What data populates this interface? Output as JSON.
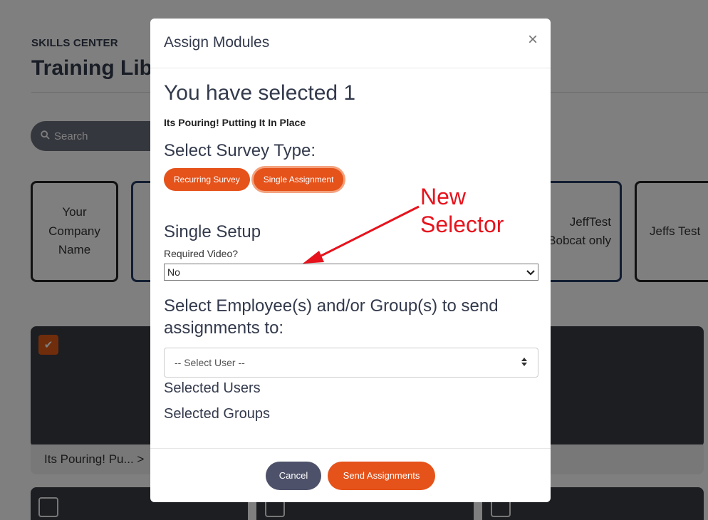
{
  "background": {
    "eyebrow": "SKILLS CENTER",
    "title": "Training Library",
    "search_placeholder": "Search",
    "cards": [
      {
        "label": "Your Company Name"
      },
      {
        "label": ""
      },
      {
        "label": "JeffTest Bobcat only"
      },
      {
        "label": "Jeffs Test"
      }
    ],
    "tile_caption": "Its Pouring! Pu... >"
  },
  "modal": {
    "title": "Assign Modules",
    "close_glyph": "×",
    "selected_heading": "You have selected 1",
    "module_name": "Its Pouring! Putting It In Place",
    "survey_heading": "Select Survey Type:",
    "survey_types": [
      "Recurring Survey",
      "Single Assignment"
    ],
    "active_survey_type": "Single Assignment",
    "setup_heading": "Single Setup",
    "required_video_label": "Required Video?",
    "required_video_value": "No",
    "employee_heading": "Select Employee(s) and/or Group(s) to send assignments to:",
    "user_select_value": "-- Select User --",
    "selected_users_heading": "Selected Users",
    "selected_groups_heading": "Selected Groups",
    "cancel_label": "Cancel",
    "send_label": "Send Assignments"
  },
  "annotation": {
    "text_line1": "New",
    "text_line2": "Selector",
    "color": "#e6131d"
  },
  "colors": {
    "accent": "#e5521a",
    "heading": "#333a4c",
    "cancel": "#4d5169"
  }
}
